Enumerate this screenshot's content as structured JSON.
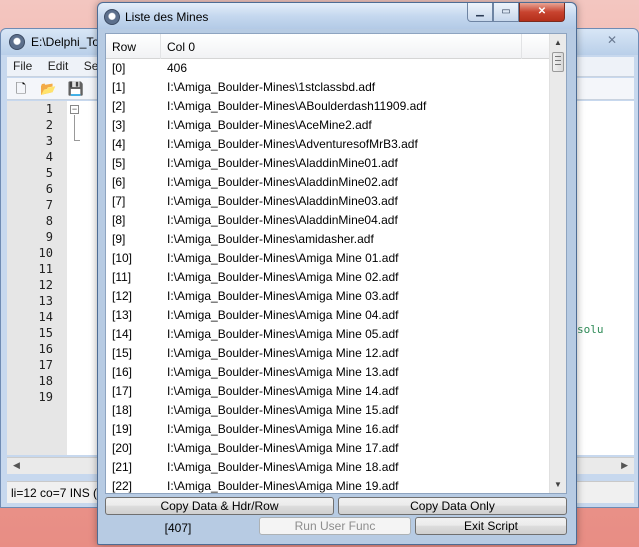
{
  "background_window": {
    "title": "E:\\Delphi_To",
    "menu": [
      "File",
      "Edit",
      "Se"
    ],
    "toolbar_icons": [
      "new-file-icon",
      "open-folder-icon",
      "save-icon",
      "page-icon"
    ],
    "line_numbers": [
      "1",
      "2",
      "3",
      "4",
      "5",
      "6",
      "7",
      "8",
      "9",
      "10",
      "11",
      "12",
      "13",
      "14",
      "15",
      "16",
      "17",
      "18",
      "19"
    ],
    "code_fragment": "solu",
    "status": "li=12 co=7 INS ("
  },
  "dialog": {
    "title": "Liste des Mines",
    "caption_buttons": {
      "minimize": "▁",
      "maximize": "▭",
      "close": "✕"
    },
    "list": {
      "headers": {
        "row": "Row",
        "col0": "Col 0"
      },
      "rows": [
        {
          "row": "[0]",
          "col0": "406"
        },
        {
          "row": "[1]",
          "col0": "I:\\Amiga_Boulder-Mines\\1stclassbd.adf"
        },
        {
          "row": "[2]",
          "col0": "I:\\Amiga_Boulder-Mines\\ABoulderdash11909.adf"
        },
        {
          "row": "[3]",
          "col0": "I:\\Amiga_Boulder-Mines\\AceMine2.adf"
        },
        {
          "row": "[4]",
          "col0": "I:\\Amiga_Boulder-Mines\\AdventuresofMrB3.adf"
        },
        {
          "row": "[5]",
          "col0": "I:\\Amiga_Boulder-Mines\\AladdinMine01.adf"
        },
        {
          "row": "[6]",
          "col0": "I:\\Amiga_Boulder-Mines\\AladdinMine02.adf"
        },
        {
          "row": "[7]",
          "col0": "I:\\Amiga_Boulder-Mines\\AladdinMine03.adf"
        },
        {
          "row": "[8]",
          "col0": "I:\\Amiga_Boulder-Mines\\AladdinMine04.adf"
        },
        {
          "row": "[9]",
          "col0": "I:\\Amiga_Boulder-Mines\\amidasher.adf"
        },
        {
          "row": "[10]",
          "col0": "I:\\Amiga_Boulder-Mines\\Amiga Mine 01.adf"
        },
        {
          "row": "[11]",
          "col0": "I:\\Amiga_Boulder-Mines\\Amiga Mine 02.adf"
        },
        {
          "row": "[12]",
          "col0": "I:\\Amiga_Boulder-Mines\\Amiga Mine 03.adf"
        },
        {
          "row": "[13]",
          "col0": "I:\\Amiga_Boulder-Mines\\Amiga Mine 04.adf"
        },
        {
          "row": "[14]",
          "col0": "I:\\Amiga_Boulder-Mines\\Amiga Mine 05.adf"
        },
        {
          "row": "[15]",
          "col0": "I:\\Amiga_Boulder-Mines\\Amiga Mine 12.adf"
        },
        {
          "row": "[16]",
          "col0": "I:\\Amiga_Boulder-Mines\\Amiga Mine 13.adf"
        },
        {
          "row": "[17]",
          "col0": "I:\\Amiga_Boulder-Mines\\Amiga Mine 14.adf"
        },
        {
          "row": "[18]",
          "col0": "I:\\Amiga_Boulder-Mines\\Amiga Mine 15.adf"
        },
        {
          "row": "[19]",
          "col0": "I:\\Amiga_Boulder-Mines\\Amiga Mine 16.adf"
        },
        {
          "row": "[20]",
          "col0": "I:\\Amiga_Boulder-Mines\\Amiga Mine 17.adf"
        },
        {
          "row": "[21]",
          "col0": "I:\\Amiga_Boulder-Mines\\Amiga Mine 18.adf"
        },
        {
          "row": "[22]",
          "col0": "I:\\Amiga_Boulder-Mines\\Amiga Mine 19.adf"
        }
      ]
    },
    "buttons": {
      "copy_hdr": "Copy Data & Hdr/Row",
      "copy_only": "Copy Data Only",
      "run_user": "Run User Func",
      "exit": "Exit Script"
    },
    "count": "[407]"
  }
}
